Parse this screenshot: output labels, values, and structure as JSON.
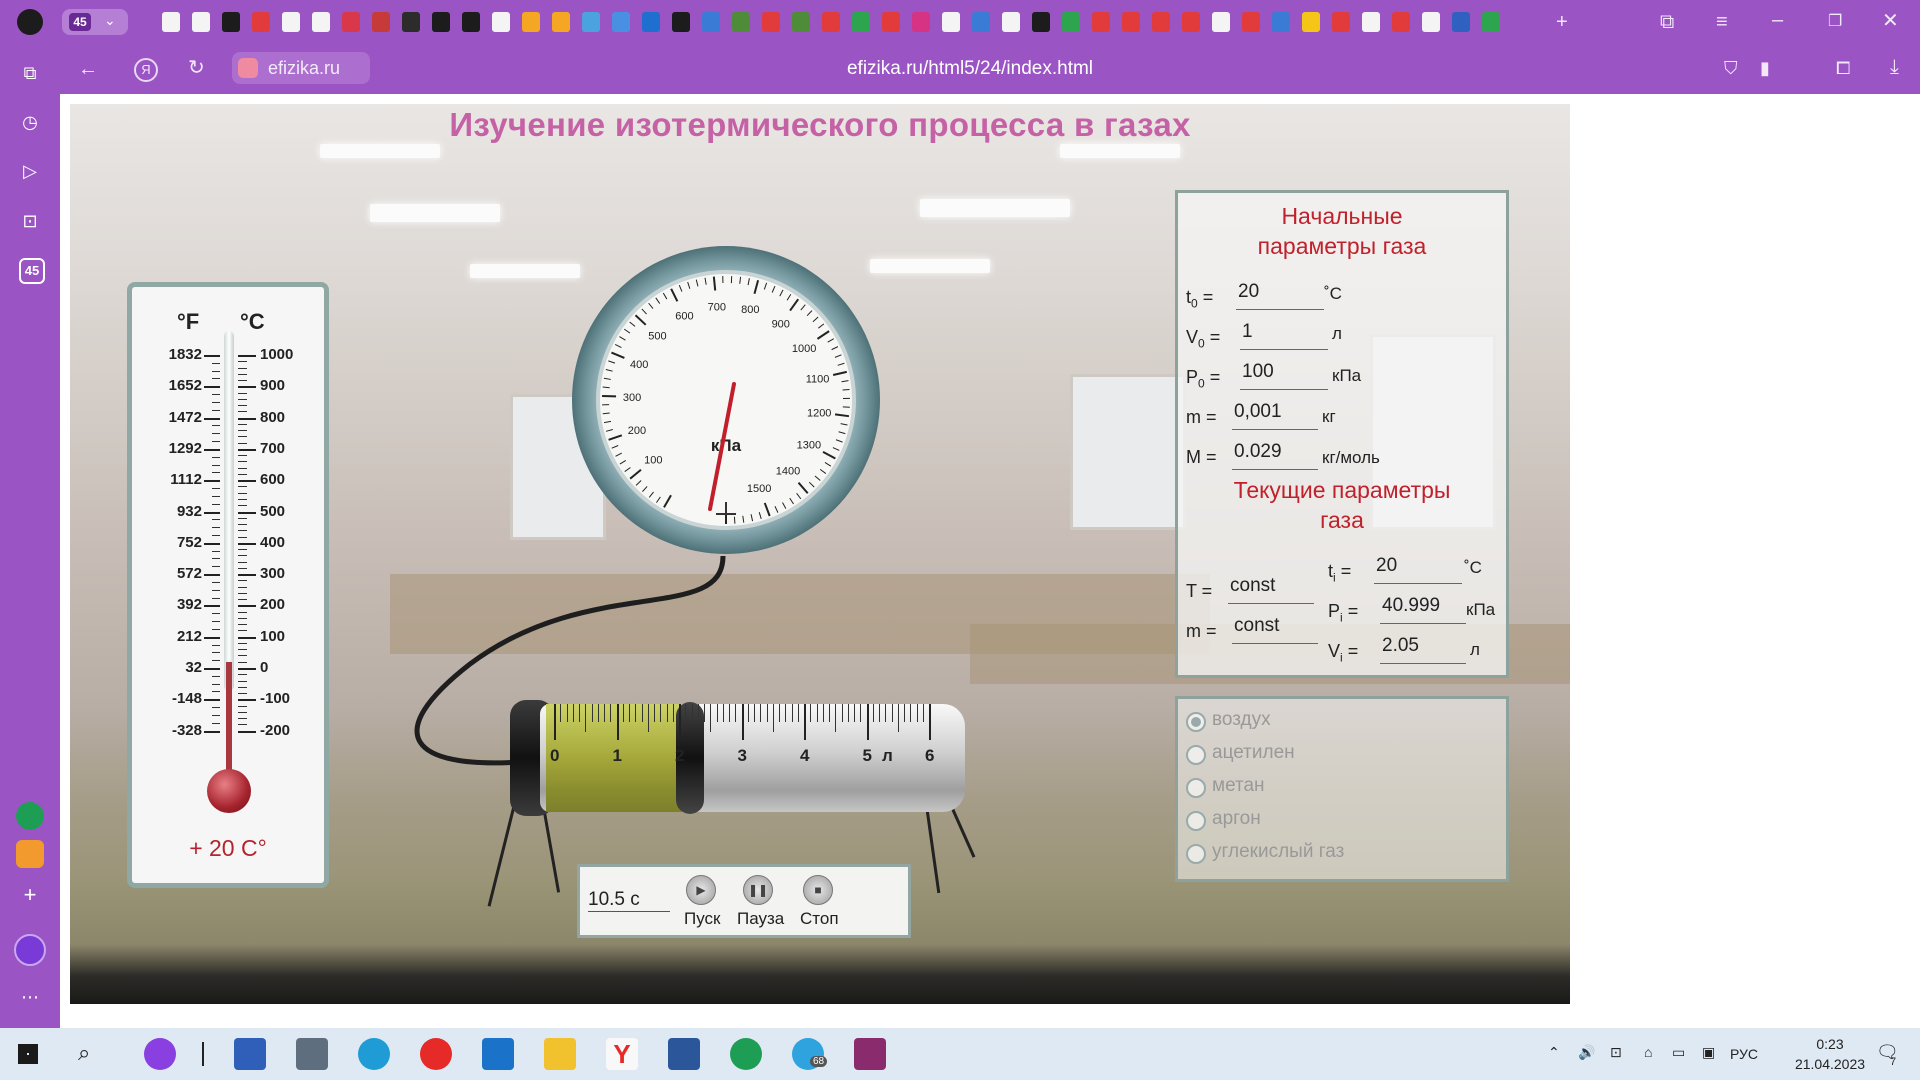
{
  "browser": {
    "tab_counter": "45",
    "site_chip": "efizika.ru",
    "url": "efizika.ru/html5/24/index.html",
    "sidebar_badge": "45",
    "colors": {
      "chrome": "#9b54c4"
    }
  },
  "page": {
    "title": "Изучение изотермического процесса в газах"
  },
  "thermometer": {
    "unit_f": "°F",
    "unit_c": "°C",
    "f_ticks": [
      "1832",
      "1652",
      "1472",
      "1292",
      "1112",
      "932",
      "752",
      "572",
      "392",
      "212",
      "32",
      "-148",
      "-328"
    ],
    "c_ticks": [
      "1000",
      "900",
      "800",
      "700",
      "600",
      "500",
      "400",
      "300",
      "200",
      "100",
      "0",
      "-100",
      "-200"
    ],
    "reading": "+ 20 С°",
    "level_c": 20
  },
  "gauge": {
    "unit": "кПа",
    "ticks": [
      "100",
      "200",
      "300",
      "400",
      "500",
      "600",
      "700",
      "800",
      "900",
      "1000",
      "1100",
      "1200",
      "1300",
      "1400",
      "1500"
    ],
    "value_kpa": 40.999
  },
  "syringe": {
    "ticks": [
      "0",
      "1",
      "2",
      "3",
      "4",
      "5",
      "6"
    ],
    "unit": "л",
    "volume_l": 2.05
  },
  "initial": {
    "heading_line1": "Начальные",
    "heading_line2": "параметры газа",
    "t0_label": "t",
    "t0_sub": "0",
    "t0_eq": " =",
    "t0_value": "20",
    "t0_unit": "˚С",
    "v0_label": "V",
    "v0_sub": "0",
    "v0_eq": " =",
    "v0_value": "1",
    "v0_unit": "л",
    "p0_label": "P",
    "p0_sub": "0",
    "p0_eq": " =",
    "p0_value": "100",
    "p0_unit": "кПа",
    "m_label": "m =",
    "m_value": "0,001",
    "m_unit": "кг",
    "M_label": "M =",
    "M_value": "0.029",
    "M_unit": "кг/моль"
  },
  "current": {
    "heading_line1": "Текущие параметры",
    "heading_line2": "газа",
    "T_label": "T =",
    "T_value": "const",
    "m_label": "m =",
    "m_value": "const",
    "ti_label": "t",
    "ti_sub": "i",
    "ti_eq": " =",
    "ti_value": "20",
    "ti_unit": "˚С",
    "pi_label": "P",
    "pi_sub": "i",
    "pi_eq": " =",
    "pi_value": "40.999",
    "pi_unit": "кПа",
    "vi_label": "V",
    "vi_sub": "i",
    "vi_eq": " =",
    "vi_value": "2.05",
    "vi_unit": "л"
  },
  "gases": {
    "items": [
      "воздух",
      "ацетилен",
      "метан",
      "аргон",
      "углекислый газ"
    ],
    "selected": 0
  },
  "controls": {
    "time": "10.5 с",
    "start_label": "Пуск",
    "pause_label": "Пауза",
    "stop_label": "Стоп"
  },
  "taskbar": {
    "lang": "РУС",
    "time": "0:23",
    "date": "21.04.2023",
    "telegram_badge": "68",
    "notif_count": "7"
  }
}
